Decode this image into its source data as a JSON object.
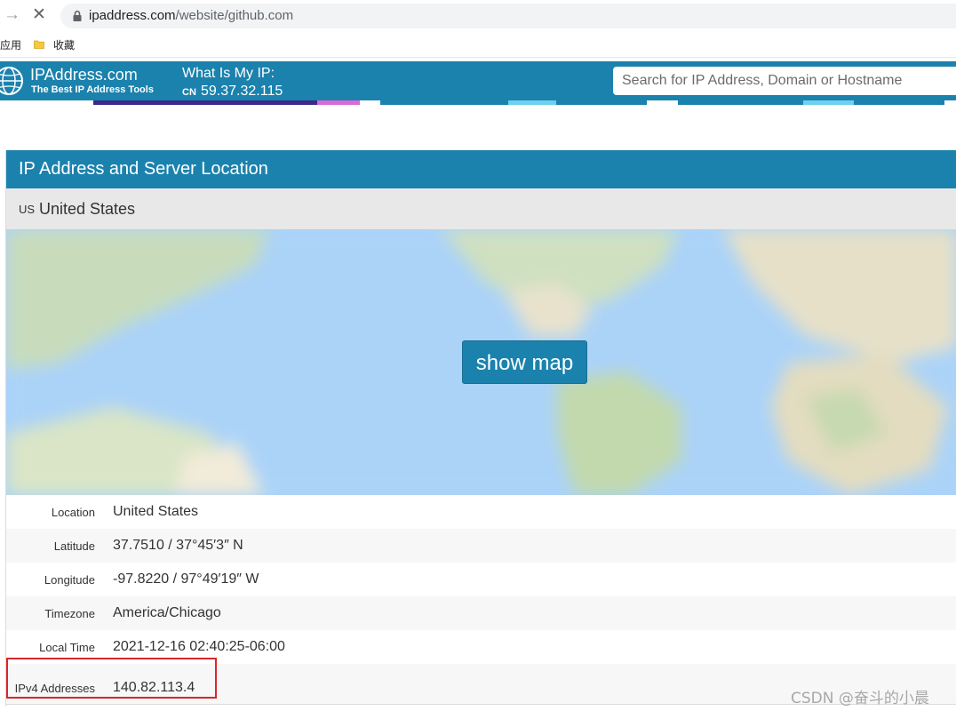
{
  "browser": {
    "url_domain": "ipaddress.com",
    "url_path": "/website/github.com",
    "nav_forward_glyph": "→",
    "nav_stop_glyph": "✕",
    "bookmarks": {
      "apps_label": "应用",
      "favorites_label": "收藏"
    },
    "icons": [
      "forward-arrow-icon",
      "stop-loading-icon",
      "lock-icon",
      "folder-icon"
    ]
  },
  "header": {
    "brand_name": "IPAddress.com",
    "brand_tagline": "The Best IP Address Tools",
    "my_ip_label": "What Is My IP:",
    "my_ip_country": "CN",
    "my_ip_value": "59.37.32.115",
    "search_placeholder": "Search for IP Address, Domain or Hostname"
  },
  "card": {
    "title": "IP Address and Server Location",
    "country_code": "US",
    "country_name": "United States",
    "show_map_label": "show map",
    "rows": [
      {
        "label": "Location",
        "value": "United States"
      },
      {
        "label": "Latitude",
        "value": "37.7510 / 37°45′3″ N"
      },
      {
        "label": "Longitude",
        "value": "-97.8220 / 97°49′19″ W"
      },
      {
        "label": "Timezone",
        "value": "America/Chicago"
      },
      {
        "label": "Local Time",
        "value": "2021-12-16 02:40:25-06:00"
      },
      {
        "label": "IPv4 Addresses",
        "value": "140.82.113.4"
      }
    ]
  },
  "watermark": "CSDN @奋斗的小晨",
  "colors": {
    "brand_blue": "#1b82ad",
    "highlight_red": "#d9262b",
    "map_ocean": "#abd3f8"
  }
}
